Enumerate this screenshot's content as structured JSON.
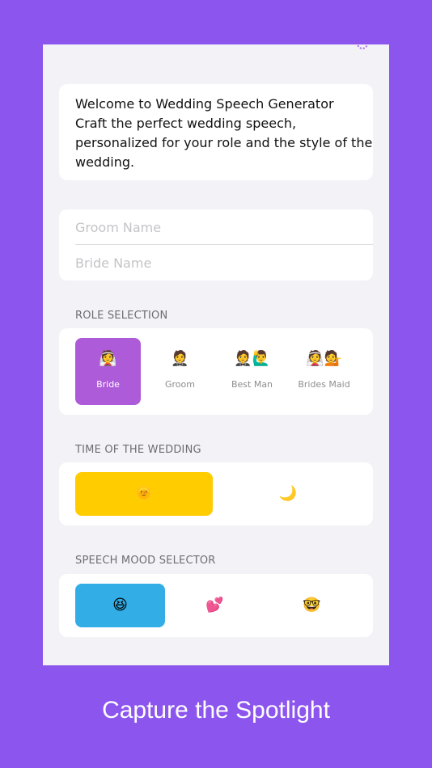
{
  "welcome": {
    "lines": [
      "Welcome to Wedding Speech Generator",
      "Craft the perfect wedding speech,",
      "personalized for your role and the style of the",
      "wedding."
    ]
  },
  "names": {
    "groom_placeholder": "Groom Name",
    "groom_value": "",
    "bride_placeholder": "Bride Name",
    "bride_value": ""
  },
  "role_selection": {
    "label": "ROLE SELECTION",
    "selected": "Bride",
    "options": [
      {
        "emoji": "👰",
        "label": "Bride"
      },
      {
        "emoji": "🤵",
        "label": "Groom"
      },
      {
        "emoji": "🤵🙋‍♂️",
        "label": "Best Man"
      },
      {
        "emoji": "👰💁",
        "label": "Brides Maid"
      }
    ]
  },
  "time_of_wedding": {
    "label": "TIME OF THE WEDDING",
    "selected": "sun",
    "options": [
      {
        "icon": "sun-icon",
        "glyph": "🌞"
      },
      {
        "icon": "moon-icon",
        "glyph": "🌙"
      }
    ]
  },
  "speech_mood": {
    "label": "SPEECH MOOD SELECTOR",
    "selected": "funny",
    "options": [
      {
        "icon": "laughing-face-icon",
        "glyph": "😆"
      },
      {
        "icon": "two-hearts-icon",
        "glyph": "💕"
      },
      {
        "icon": "nerd-face-icon",
        "glyph": "🤓"
      }
    ]
  },
  "colors": {
    "background": "#8c55ee",
    "role_selected": "#ad5bd9",
    "time_selected": "#ffcc00",
    "mood_selected": "#32ade6"
  },
  "caption": "Capture the Spotlight"
}
